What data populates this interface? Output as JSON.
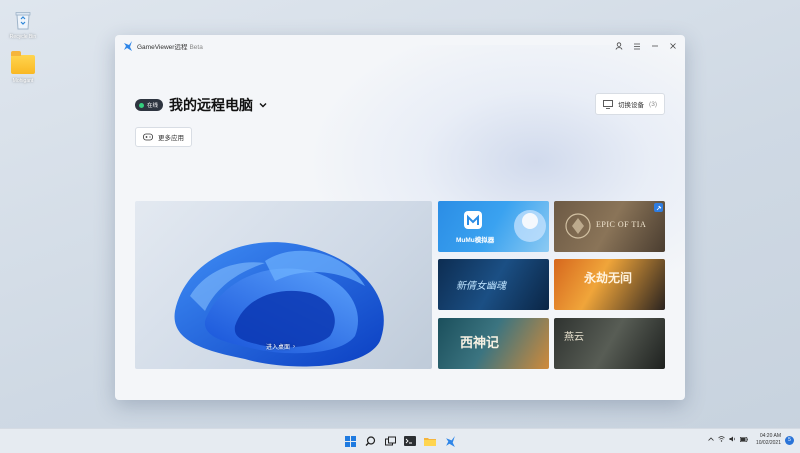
{
  "desktop": {
    "icons": [
      {
        "label": "Recycle Bin"
      },
      {
        "label": "Mohigant"
      }
    ]
  },
  "window": {
    "app_title": "GameViewer远程",
    "beta": "Beta",
    "header": {
      "online_label": "在线",
      "pc_title": "我的远程电脑",
      "caret": "⌄"
    },
    "switch_device": {
      "label": "切换设备",
      "count": "(3)"
    },
    "more_apps": {
      "label": "更多应用"
    },
    "hero": {
      "enter_label": "进入桌面",
      "arrow": "›"
    },
    "tiles": [
      {
        "label": "MuMu模拟器"
      },
      {
        "label": "EPIC OF TIA"
      },
      {
        "label": "新倩女幽魂"
      },
      {
        "label": "永劫无间"
      },
      {
        "label": "西神记"
      },
      {
        "label": "燕云"
      }
    ]
  },
  "taskbar": {
    "time": "04:20 AM",
    "date": "10/02/2021",
    "notif_count": "5"
  },
  "colors": {
    "accent": "#2f7de1",
    "online": "#35d07f",
    "badge_bg": "#2e3540"
  }
}
